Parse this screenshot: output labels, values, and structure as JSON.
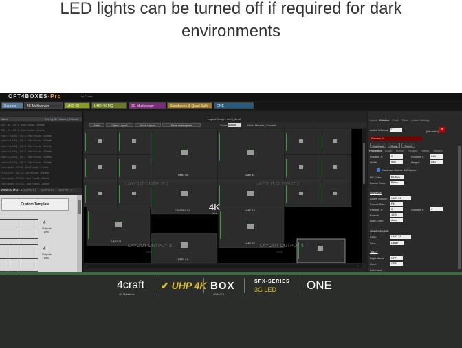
{
  "caption": {
    "line1": "LED lights can be turned off if required for dark",
    "line2": "environments"
  },
  "app": {
    "title": "OFT4BOXES",
    "title_suffix": "-Pro",
    "by": "by Cortex"
  },
  "tabs": [
    {
      "label": "Sources",
      "selected": false,
      "color": "#5a7a9a"
    },
    {
      "label": "4K Multiviewer",
      "selected": true,
      "color": "#3a3a3a"
    },
    {
      "label": "UHD 4K",
      "selected": false,
      "color": "#8a9a2a"
    },
    {
      "label": "UHD 4K MQ",
      "selected": false,
      "color": "#6a7a2a"
    },
    {
      "label": "3G Multiviewer",
      "selected": false,
      "color": "#7a2a7a"
    },
    {
      "label": "Standalone & Quad Split",
      "selected": false,
      "color": "#9a7a2a"
    },
    {
      "label": "ONE",
      "selected": false,
      "color": "#2a5a7a"
    }
  ],
  "left": {
    "header": "Name",
    "sort_label": "List by ID | Name | Refresh",
    "sources": [
      "SDI - IN - SD 1 - Not Found - Delete",
      "SDI - IN - SD 2 - Not Found - Delete",
      "Cam 1 (UHD) - SD 3 - Not Found - Delete",
      "Cam 2 (UHD) - SD 4 - Not Found - Delete",
      "Cam 3 (UHD) - SD 5 - Not Found - Delete",
      "Cam 4 (UHD) - SD 6 - Not Found - Delete",
      "Cam 5 (UHD) - SD 7 - Not Found - Delete",
      "Cam 6 (UHD) - SD 8 - Not Found - Delete",
      "Cam Audio - SD 9 - Not Found - Delete",
      "PLAYOUT - SD 10 - Not Found - Delete",
      "Cam Audio - SD 11 - Not Found - Delete",
      "Cam Audio - SD 12 - Not Found - Delete"
    ],
    "output_tabs": [
      "Video OUTPUT 1",
      "OUTPUT 2",
      "OUTPUT 3",
      "OUTPUT 4"
    ],
    "template_button": "Custom Template",
    "template_items": [
      {
        "num": "4",
        "label": "Outputs UHD"
      },
      {
        "num": "4",
        "label": "Outputs UHD"
      }
    ]
  },
  "center": {
    "design_title": "Layout Design: m1/4_4k.xif",
    "toolbar": [
      "New",
      "Open Layout",
      "Save Layout",
      "Save as template"
    ],
    "zoom_label": "Zoom:",
    "zoom_value": "Adjust",
    "view_label": "View: Monitor | Content",
    "watermarks": [
      {
        "text": "LAYOUT OUTPUT 1"
      },
      {
        "text": "LAYOUT OUTPUT 2"
      },
      {
        "text": "LAYOUT OUTPUT 3",
        "sub": "SDI3"
      },
      {
        "text": "LAYOUT OUTPUT 4",
        "sub": "SDI4"
      }
    ],
    "badge": {
      "big": "4K",
      "small": "HDMI"
    },
    "windows": [
      {
        "label": "UMD 09"
      },
      {
        "label": "UMD 11"
      },
      {
        "label": "CAMERA 01"
      },
      {
        "label": "UMD 13"
      },
      {
        "label": "UMD 21"
      },
      {
        "label": "UMD 22"
      },
      {
        "label": "UMD 24"
      }
    ]
  },
  "right": {
    "tabs": [
      "Layout",
      "Window",
      "Clock",
      "Timer",
      "Admin Settings"
    ],
    "active_window_label": "Active Window:",
    "active_window_value": "21",
    "delete_label": "[del mark]",
    "preview_select": "Preview 01",
    "buttons": [
      "Duplicate",
      "Copy",
      "Reset"
    ],
    "subtabs": [
      "Properties",
      "Audio",
      "Border",
      "Scopes",
      "Safety",
      "Alarms"
    ],
    "position_x_label": "Position X:",
    "position_x": "0",
    "position_y_label": "Position Y:",
    "position_y": "540",
    "width_label": "Width:",
    "width": "960",
    "height_label": "Height:",
    "height": "540",
    "constrain": "Constrain Source & Window",
    "bg_color_label": "BG Color:",
    "bg_color": "BLACK",
    "border_color_label": "Border Color:",
    "border_color": "Black",
    "source_header": "SOURCE",
    "active_source_label": "Active Source:",
    "active_source": "UMD 21",
    "source_size_label": "Source Size:",
    "source_size": "Fit",
    "spos_x_label": "Position X:",
    "spos_x": "0",
    "spos_y_label": "Position Y:",
    "spos_y": "0",
    "format_label": "Format:",
    "format": "16:9",
    "data_conv_label": "Data Conv:",
    "data_conv": "Auto",
    "umd_header": "SOURCE UMD",
    "umd_label": "UMD:",
    "umd": "UMD 21",
    "size_label": "Size:",
    "size": "Large",
    "tally_header": "TALLY",
    "right_hand_label": "Right Hand:",
    "right_hand": "OFF",
    "umd2_label": "Umd:",
    "umd2": "OFF",
    "left_hand_label": "Left Hand:"
  },
  "footer": {
    "brands": [
      {
        "main": "4craft",
        "sub": "4K Multiview"
      },
      {
        "main": "UHP 4K",
        "sub": ""
      },
      {
        "main": "BOX",
        "sub": "4BOXES"
      },
      {
        "main": "SFX-SERIES",
        "sub": "3G LED"
      },
      {
        "main": "ONE",
        "sub": ""
      }
    ]
  }
}
